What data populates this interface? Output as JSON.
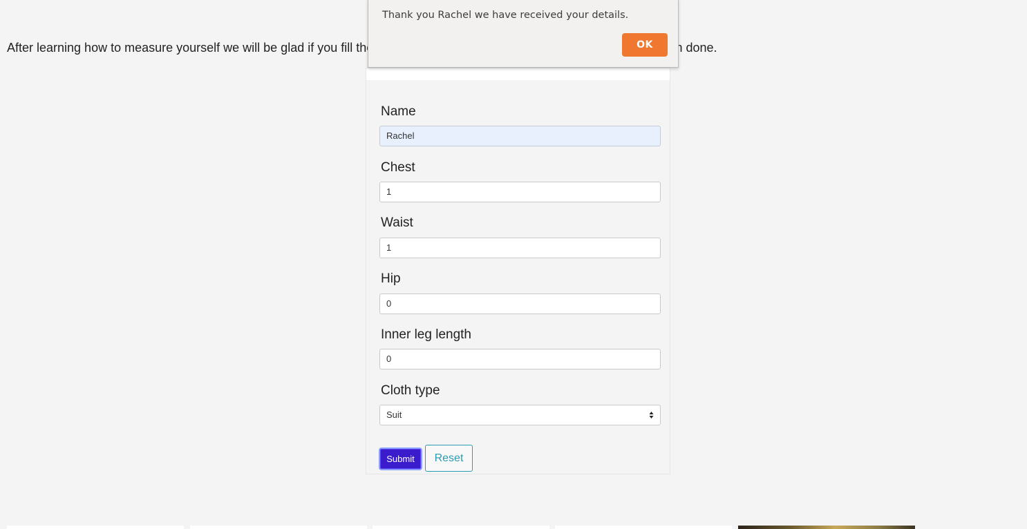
{
  "intro_text": "After learning how to measure yourself we will be glad if you fill the form below to let us know your size and have your cloth done.",
  "form": {
    "fields": [
      {
        "label": "Name",
        "value": "Rachel"
      },
      {
        "label": "Chest",
        "value": "1"
      },
      {
        "label": "Waist",
        "value": "1"
      },
      {
        "label": "Hip",
        "value": "0"
      },
      {
        "label": "Inner leg length",
        "value": "0"
      }
    ],
    "cloth_type": {
      "label": "Cloth type",
      "selected": "Suit"
    },
    "submit_label": "Submit",
    "reset_label": "Reset"
  },
  "dialog": {
    "message": "Thank you Rachel we have received your details.",
    "ok_label": "OK"
  },
  "colors": {
    "submit": "#3a1ccc",
    "reset": "#2a9bb0",
    "ok": "#f0772f",
    "autofill": "#e8f0fe"
  }
}
